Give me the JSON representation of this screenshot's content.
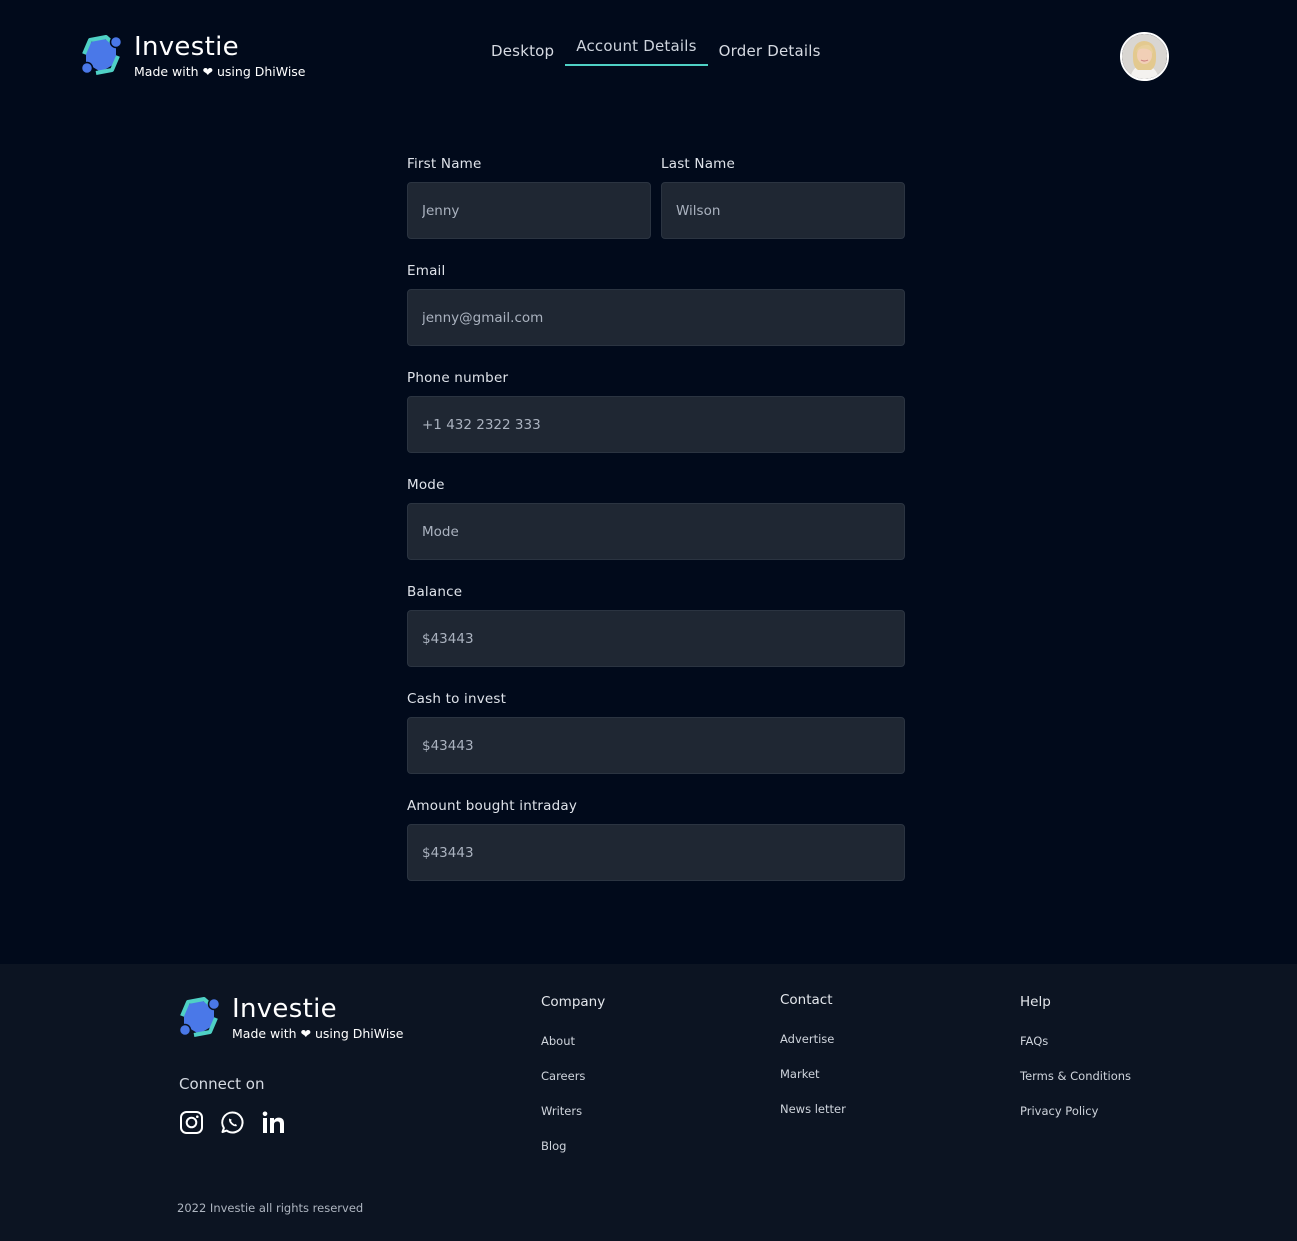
{
  "brand": {
    "name": "Investie",
    "tagline": "Made with ❤ using DhiWise",
    "colors": {
      "teal": "#4fd1c5",
      "blue": "#4a78e8",
      "background": "#010a1b",
      "footer": "#0c1422"
    }
  },
  "nav": {
    "tabs": [
      {
        "label": "Desktop"
      },
      {
        "label": "Account Details"
      },
      {
        "label": "Order Details"
      }
    ],
    "active": "Account Details"
  },
  "user": {
    "avatar": "user-avatar"
  },
  "form": {
    "first_name": {
      "label": "First Name",
      "value": "Jenny"
    },
    "last_name": {
      "label": "Last Name",
      "value": "Wilson"
    },
    "email": {
      "label": "Email",
      "value": "jenny@gmail.com"
    },
    "phone": {
      "label": "Phone number",
      "value": "+1 432 2322 333"
    },
    "mode": {
      "label": "Mode",
      "placeholder": "Mode"
    },
    "balance": {
      "label": "Balance",
      "value": "$43443"
    },
    "cash": {
      "label": "Cash to invest",
      "value": "$43443"
    },
    "intraday": {
      "label": "Amount bought intraday",
      "value": "$43443"
    }
  },
  "footer": {
    "connect_label": "Connect on",
    "socials": [
      "instagram-icon",
      "whatsapp-icon",
      "linkedin-icon"
    ],
    "company": {
      "title": "Company",
      "links": [
        "About",
        "Careers",
        "Writers",
        "Blog"
      ]
    },
    "contact": {
      "title": "Contact",
      "links": [
        "Advertise",
        "Market",
        "News letter"
      ]
    },
    "help": {
      "title": "Help",
      "links": [
        "FAQs",
        "Terms & Conditions",
        "Privacy Policy"
      ]
    },
    "copyright": "2022 Investie all rights reserved"
  }
}
